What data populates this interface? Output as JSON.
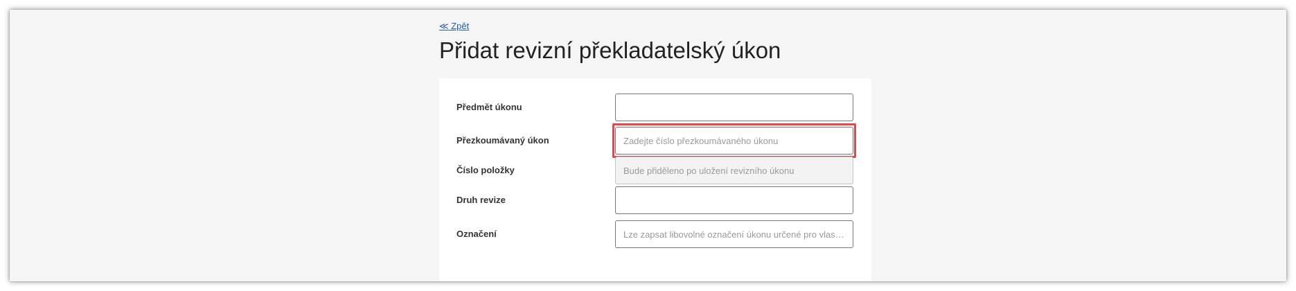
{
  "nav": {
    "back_label": "≪ Zpět"
  },
  "page": {
    "title": "Přidat revizní překladatelský úkon"
  },
  "form": {
    "fields": [
      {
        "label": "Předmět úkonu",
        "value": "",
        "placeholder": ""
      },
      {
        "label": "Přezkoumávaný úkon",
        "value": "",
        "placeholder": "Zadejte číslo přezkoumávaného úkonu"
      },
      {
        "label": "Číslo položky",
        "value": "",
        "placeholder": "Bude přiděleno po uložení revizního úkonu"
      },
      {
        "label": "Druh revize",
        "value": "",
        "placeholder": ""
      },
      {
        "label": "Označení",
        "value": "",
        "placeholder": "Lze zapsat libovolné označení úkonu určené pro vlastní evidenci"
      }
    ]
  },
  "colors": {
    "link": "#1f5fa8",
    "highlight": "#e2474d",
    "background": "#f5f5f5"
  }
}
